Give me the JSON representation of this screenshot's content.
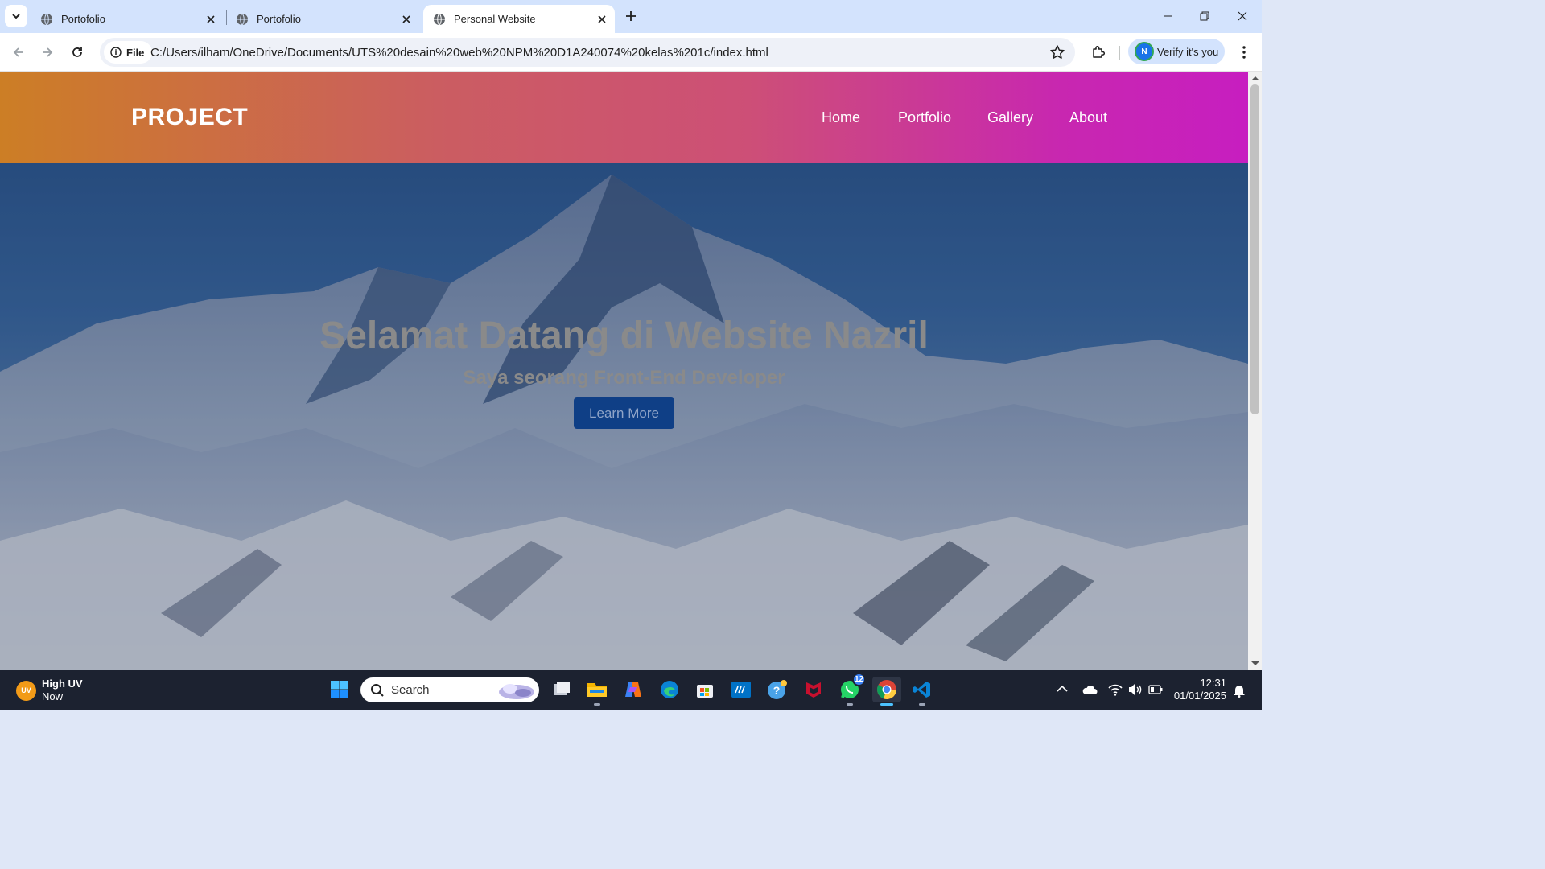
{
  "browser": {
    "tabs": [
      {
        "title": "Portofolio",
        "active": false
      },
      {
        "title": "Portofolio",
        "active": false
      },
      {
        "title": "Personal Website",
        "active": true
      }
    ],
    "site_chip_label": "File",
    "url": "C:/Users/ilham/OneDrive/Documents/UTS%20desain%20web%20NPM%20D1A240074%20kelas%201c/index.html",
    "profile": {
      "initial": "N",
      "label": "Verify it's you"
    }
  },
  "site": {
    "brand": "PROJECT",
    "nav": [
      "Home",
      "Portfolio",
      "Gallery",
      "About"
    ],
    "hero": {
      "title": "Selamat Datang di Website Nazril",
      "subtitle": "Saya seorang Front-End Developer",
      "button": "Learn More"
    },
    "colors": {
      "header_gradient_start": "#cc7e25",
      "header_gradient_end": "#c71ec0",
      "button": "#0f3f86"
    }
  },
  "taskbar": {
    "weather": {
      "badge": "UV",
      "title": "High UV",
      "subtitle": "Now"
    },
    "search_label": "Search",
    "whatsapp_badge": "12",
    "time": "12:31",
    "date": "01/01/2025",
    "apps": [
      "start-icon",
      "task-view-icon",
      "file-explorer-icon",
      "copilot-icon",
      "edge-icon",
      "store-icon",
      "myhp-icon",
      "help-icon",
      "mcafee-icon",
      "whatsapp-icon",
      "chrome-icon",
      "vscode-icon"
    ]
  }
}
